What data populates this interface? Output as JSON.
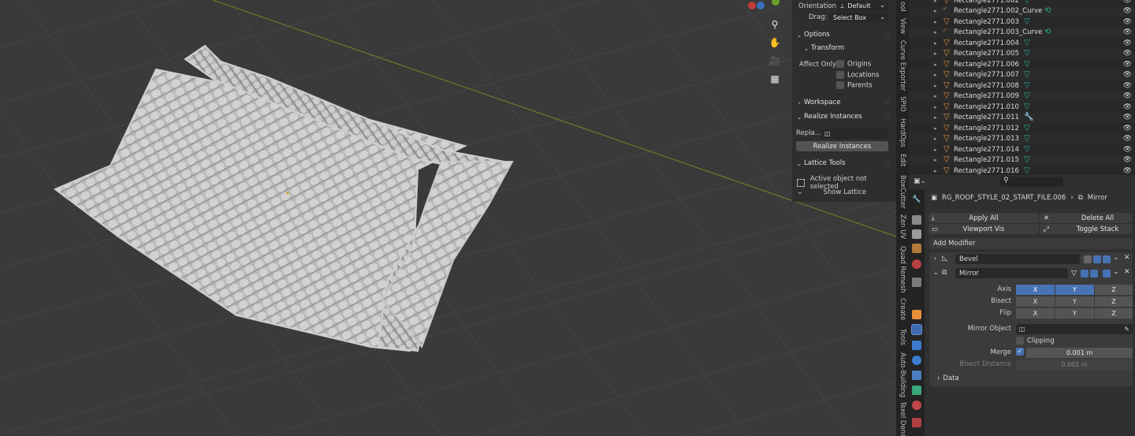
{
  "npanel": {
    "orientation_label": "Orientation",
    "orientation_value": "Default",
    "drag_label": "Drag:",
    "drag_value": "Select Box",
    "options": "Options",
    "transform": "Transform",
    "affect_only": "Affect Only",
    "origins": "Origins",
    "locations": "Locations",
    "parents": "Parents",
    "workspace": "Workspace",
    "realize_instances": "Realize Instances",
    "replace_label": "Repla...",
    "realize_button": "Realize Instances",
    "lattice_tools": "Lattice Tools",
    "active_object": "Active object not selected",
    "show_lattice": "Show Lattice"
  },
  "vertical_tabs": [
    "ool",
    "View",
    "Curve Exporter",
    "SPIO",
    "HardOps",
    "Edit",
    "BoxCutter",
    "Zen UV",
    "Quad Remesh",
    "Create",
    "Tools",
    "Auto-Building",
    "Texel Dens"
  ],
  "outliner": {
    "rows": [
      "Rectangle2771.002",
      "Rectangle2771.002_Curve",
      "Rectangle2771.003",
      "Rectangle2771.003_Curve",
      "Rectangle2771.004",
      "Rectangle2771.005",
      "Rectangle2771.006",
      "Rectangle2771.007",
      "Rectangle2771.008",
      "Rectangle2771.009",
      "Rectangle2771.010",
      "Rectangle2771.011",
      "Rectangle2771.012",
      "Rectangle2771.013",
      "Rectangle2771.014",
      "Rectangle2771.015",
      "Rectangle2771.016"
    ]
  },
  "properties": {
    "object_name": "RG_ROOF_STYLE_02_START_FILE.006",
    "modifier_crumb": "Mirror",
    "apply_all": "Apply All",
    "delete_all": "Delete All",
    "viewport_vis": "Viewport Vis",
    "toggle_stack": "Toggle Stack",
    "add_modifier": "Add Modifier",
    "bevel_name": "Bevel",
    "mirror_name": "Mirror",
    "axis_label": "Axis",
    "bisect_label": "Bisect",
    "flip_label": "Flip",
    "x": "X",
    "y": "Y",
    "z": "Z",
    "mirror_object_label": "Mirror Object",
    "clipping": "Clipping",
    "merge_label": "Merge",
    "merge_value": "0.001 m",
    "bisect_distance_label": "Bisect Distance",
    "bisect_distance_value": "0.001 m",
    "data": "Data"
  },
  "colors": {
    "accent": "#4772b3",
    "mesh_icon": "#e8913a",
    "modifier_icon": "#27b3a0"
  }
}
